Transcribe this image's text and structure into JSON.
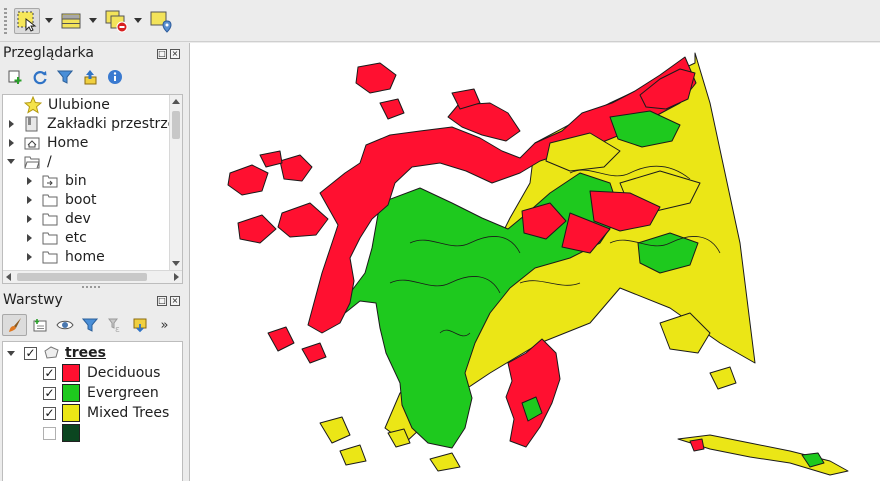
{
  "toolbar": {
    "tools": [
      {
        "icon": "select-features-icon",
        "has_dropdown": true,
        "selected": true
      },
      {
        "icon": "attribute-table-icon",
        "has_dropdown": true
      },
      {
        "icon": "deselect-features-icon",
        "has_dropdown": true
      },
      {
        "icon": "identify-features-icon",
        "has_dropdown": false
      }
    ]
  },
  "browser_panel": {
    "title": "Przeglądarka",
    "toolbar_icons": [
      "add-layer-icon",
      "refresh-icon",
      "filter-icon",
      "collapse-all-icon",
      "info-icon"
    ],
    "items": [
      {
        "label": "Ulubione",
        "icon": "star-icon",
        "level": 0,
        "expander": "none"
      },
      {
        "label": "Zakładki przestrze",
        "icon": "bookmarks-icon",
        "level": 0,
        "expander": "right"
      },
      {
        "label": "Home",
        "icon": "home-folder-icon",
        "level": 0,
        "expander": "right"
      },
      {
        "label": "/",
        "icon": "folder-open-icon",
        "level": 0,
        "expander": "down"
      },
      {
        "label": "bin",
        "icon": "folder-link-icon",
        "level": 1,
        "expander": "right"
      },
      {
        "label": "boot",
        "icon": "folder-icon",
        "level": 1,
        "expander": "right"
      },
      {
        "label": "dev",
        "icon": "folder-icon",
        "level": 1,
        "expander": "right"
      },
      {
        "label": "etc",
        "icon": "folder-icon",
        "level": 1,
        "expander": "right"
      },
      {
        "label": "home",
        "icon": "folder-icon",
        "level": 1,
        "expander": "right"
      }
    ]
  },
  "layers_panel": {
    "title": "Warstwy",
    "toolbar_icons": [
      "style-brush-icon",
      "add-group-icon",
      "visibility-eye-icon",
      "filter-legend-icon",
      "expression-filter-icon",
      "remove-layer-icon",
      "more-chevron-icon"
    ],
    "layer": {
      "name": "trees",
      "checked": true
    },
    "classes": [
      {
        "label": "Deciduous",
        "color": "#ff1030",
        "checked": true
      },
      {
        "label": "Evergreen",
        "color": "#1ec91e",
        "checked": true
      },
      {
        "label": "Mixed Trees",
        "color": "#ebe616",
        "checked": true
      },
      {
        "label": "",
        "color": "#0b4620",
        "checked": false
      }
    ]
  },
  "map": {
    "background": "#ffffff",
    "outline_color": "#1a1a1a",
    "class_colors": {
      "deciduous": "#ff1030",
      "evergreen": "#1ec91e",
      "mixed": "#ebe616"
    }
  }
}
